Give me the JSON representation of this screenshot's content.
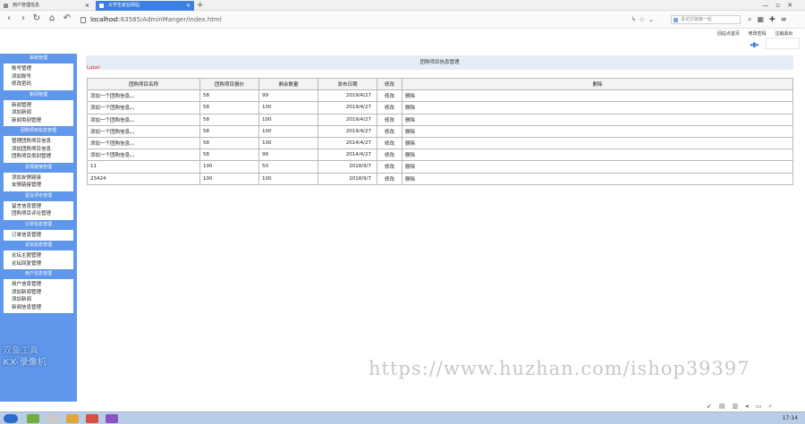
{
  "browser": {
    "tabs": [
      {
        "label": "用户管理信息",
        "active": false
      },
      {
        "label": "大学生就业网站",
        "active": true
      }
    ],
    "new_tab": "+",
    "address": {
      "host": "localhost",
      "rest": ":63585/AdminManger/index.html"
    },
    "search_placeholder": "青花打破第一轮",
    "nav_icons": [
      "back-icon",
      "forward-icon",
      "reload-icon",
      "home-icon",
      "undo-icon"
    ]
  },
  "top_links": {
    "home": "回站点首页",
    "change_password": "修改密码",
    "logout": "注销退出"
  },
  "sidebar": {
    "groups": [
      {
        "header": "系统管理",
        "items": [
          "账号管理",
          "添加账号",
          "修改密码"
        ]
      },
      {
        "header": "新闻管理",
        "items": [
          "新闻管理",
          "添加新闻",
          "新闻类别管理"
        ]
      },
      {
        "header": "团购项目信息管理",
        "items": [
          "管理团购项目信息",
          "添加团购项目信息",
          "团购项目类别管理"
        ]
      },
      {
        "header": "友情链接管理",
        "items": [
          "添加友情链接",
          "友情链接管理"
        ]
      },
      {
        "header": "留言评论管理",
        "items": [
          "留言信息管理",
          "团购项目评论管理"
        ]
      },
      {
        "header": "订单信息管理",
        "items": [
          "订单信息管理"
        ]
      },
      {
        "header": "论坛信息管理",
        "items": [
          "论坛主题管理",
          "论坛回复管理"
        ]
      },
      {
        "header": "用户信息管理",
        "items": [
          "用户信息管理",
          "添加新闻管理",
          "添加新闻",
          "新闻信息管理"
        ]
      }
    ]
  },
  "main": {
    "title": "团购项目信息管理",
    "label": "Label",
    "table": {
      "headers": [
        "团购项目名称",
        "团购项目报价",
        "剩余数量",
        "发布日期",
        "修改",
        "删除"
      ],
      "rows": [
        [
          "添加一个团购信息。。",
          "58",
          "99",
          "2019/4/27",
          "修改",
          "删除"
        ],
        [
          "添加一个团购信息。。",
          "58",
          "100",
          "2019/4/27",
          "修改",
          "删除"
        ],
        [
          "添加一个团购信息。。",
          "58",
          "100",
          "2019/4/27",
          "修改",
          "删除"
        ],
        [
          "添加一个团购信息。。",
          "58",
          "100",
          "2014/4/27",
          "修改",
          "删除"
        ],
        [
          "添加一个团购信息。。",
          "58",
          "100",
          "2014/4/27",
          "修改",
          "删除"
        ],
        [
          "添加一个团购信息。。",
          "58",
          "99",
          "2014/4/27",
          "修改",
          "删除"
        ],
        [
          "11",
          "100",
          "50",
          "2018/9/7",
          "修改",
          "删除"
        ],
        [
          "23424",
          "100",
          "100",
          "2018/9/7",
          "修改",
          "删除"
        ]
      ]
    }
  },
  "taskbar": {
    "clock": "17:14"
  },
  "watermark": {
    "url": "https://www.huzhan.com/ishop39397",
    "logo_line1": "双鱼工具",
    "logo_line2": "KX-录像机"
  },
  "colors": {
    "sidebar": "#5f97ed",
    "accent_tab": "#3c7fe0",
    "label_red": "#e5303a"
  }
}
